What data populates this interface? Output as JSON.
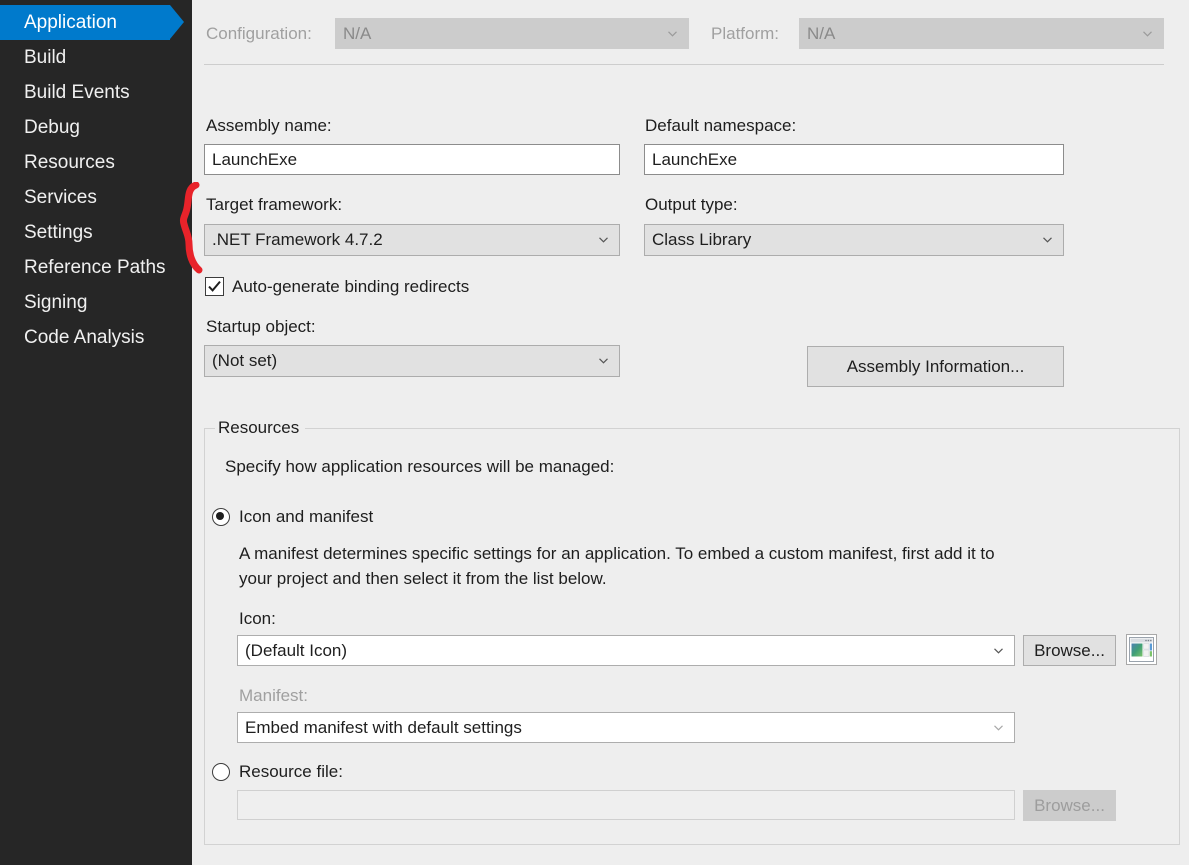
{
  "sidebar": {
    "items": [
      {
        "label": "Application",
        "selected": true
      },
      {
        "label": "Build",
        "selected": false
      },
      {
        "label": "Build Events",
        "selected": false
      },
      {
        "label": "Debug",
        "selected": false
      },
      {
        "label": "Resources",
        "selected": false
      },
      {
        "label": "Services",
        "selected": false
      },
      {
        "label": "Settings",
        "selected": false
      },
      {
        "label": "Reference Paths",
        "selected": false
      },
      {
        "label": "Signing",
        "selected": false
      },
      {
        "label": "Code Analysis",
        "selected": false
      }
    ]
  },
  "toolbar": {
    "configuration_label": "Configuration:",
    "configuration_value": "N/A",
    "platform_label": "Platform:",
    "platform_value": "N/A"
  },
  "application": {
    "assembly_name_label": "Assembly name:",
    "assembly_name_value": "LaunchExe",
    "default_namespace_label": "Default namespace:",
    "default_namespace_value": "LaunchExe",
    "target_framework_label": "Target framework:",
    "target_framework_value": ".NET Framework 4.7.2",
    "output_type_label": "Output type:",
    "output_type_value": "Class Library",
    "auto_binding_redirects_label": "Auto-generate binding redirects",
    "auto_binding_redirects_checked": true,
    "startup_object_label": "Startup object:",
    "startup_object_value": "(Not set)",
    "assembly_information_button": "Assembly Information..."
  },
  "resources": {
    "group_title": "Resources",
    "description": "Specify how application resources will be managed:",
    "icon_and_manifest_label": "Icon and manifest",
    "icon_and_manifest_selected": true,
    "manifest_description": "A manifest determines specific settings for an application. To embed a custom manifest, first add it to your project and then select it from the list below.",
    "icon_label": "Icon:",
    "icon_value": "(Default Icon)",
    "icon_browse_button": "Browse...",
    "manifest_label": "Manifest:",
    "manifest_value": "Embed manifest with default settings",
    "resource_file_label": "Resource file:",
    "resource_file_selected": false,
    "resource_file_value": "",
    "resource_file_browse_button": "Browse..."
  },
  "colors": {
    "sidebar_bg": "#262626",
    "selection_blue": "#007acc",
    "panel_bg": "#eeeeee",
    "annotation_red": "#e8232a"
  }
}
